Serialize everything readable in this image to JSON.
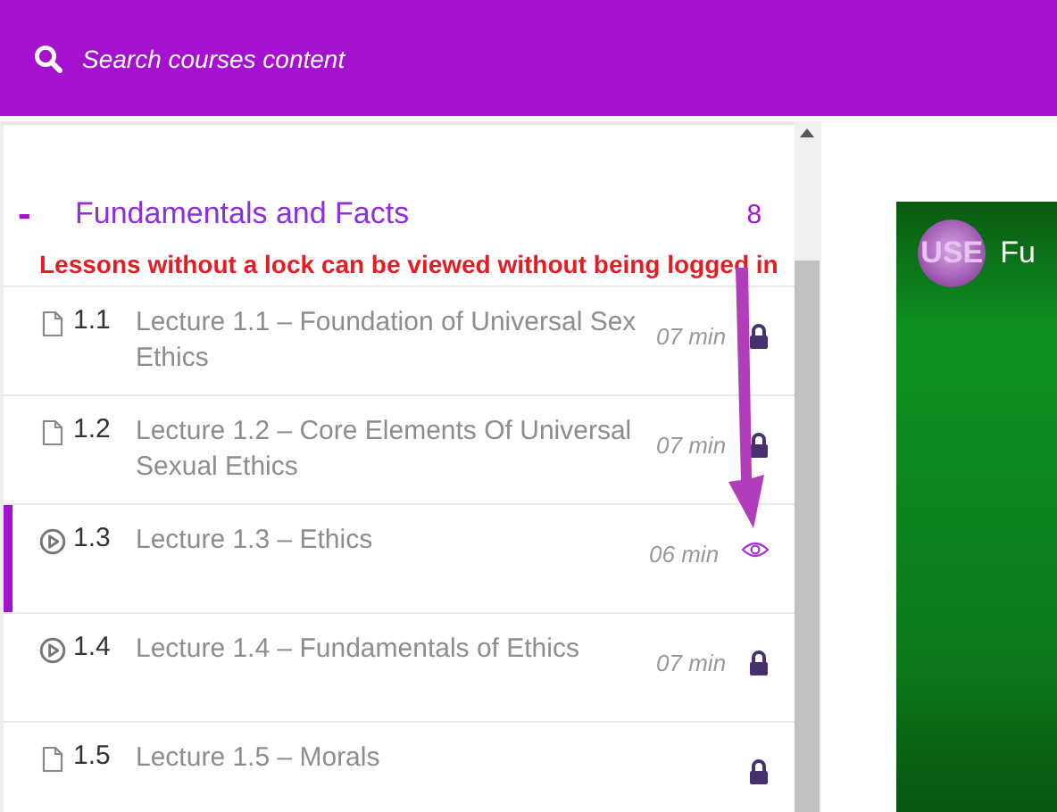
{
  "search": {
    "placeholder": "Search courses content"
  },
  "section": {
    "toggle": "-",
    "title": "Fundamentals and Facts",
    "count": "8",
    "expanded": true
  },
  "annotation": "Lessons without a lock can be viewed without being logged in",
  "lessons": [
    {
      "kind": "document",
      "number": "1.1",
      "title": "Lecture 1.1 – Foundation of Universal Sex Ethics",
      "duration": "07 min",
      "locked": true,
      "selected": false
    },
    {
      "kind": "document",
      "number": "1.2",
      "title": "Lecture 1.2 – Core Elements Of Universal Sexual Ethics",
      "duration": "07 min",
      "locked": true,
      "selected": false
    },
    {
      "kind": "video",
      "number": "1.3",
      "title": "Lecture 1.3 – Ethics",
      "duration": "06 min",
      "locked": false,
      "selected": true
    },
    {
      "kind": "video",
      "number": "1.4",
      "title": "Lecture 1.4 – Fundamentals of Ethics",
      "duration": "07 min",
      "locked": true,
      "selected": false
    },
    {
      "kind": "document",
      "number": "1.5",
      "title": "Lecture 1.5 – Morals",
      "locked": true,
      "selected": false
    }
  ],
  "video": {
    "logo": "USE",
    "title": "Fu"
  }
}
